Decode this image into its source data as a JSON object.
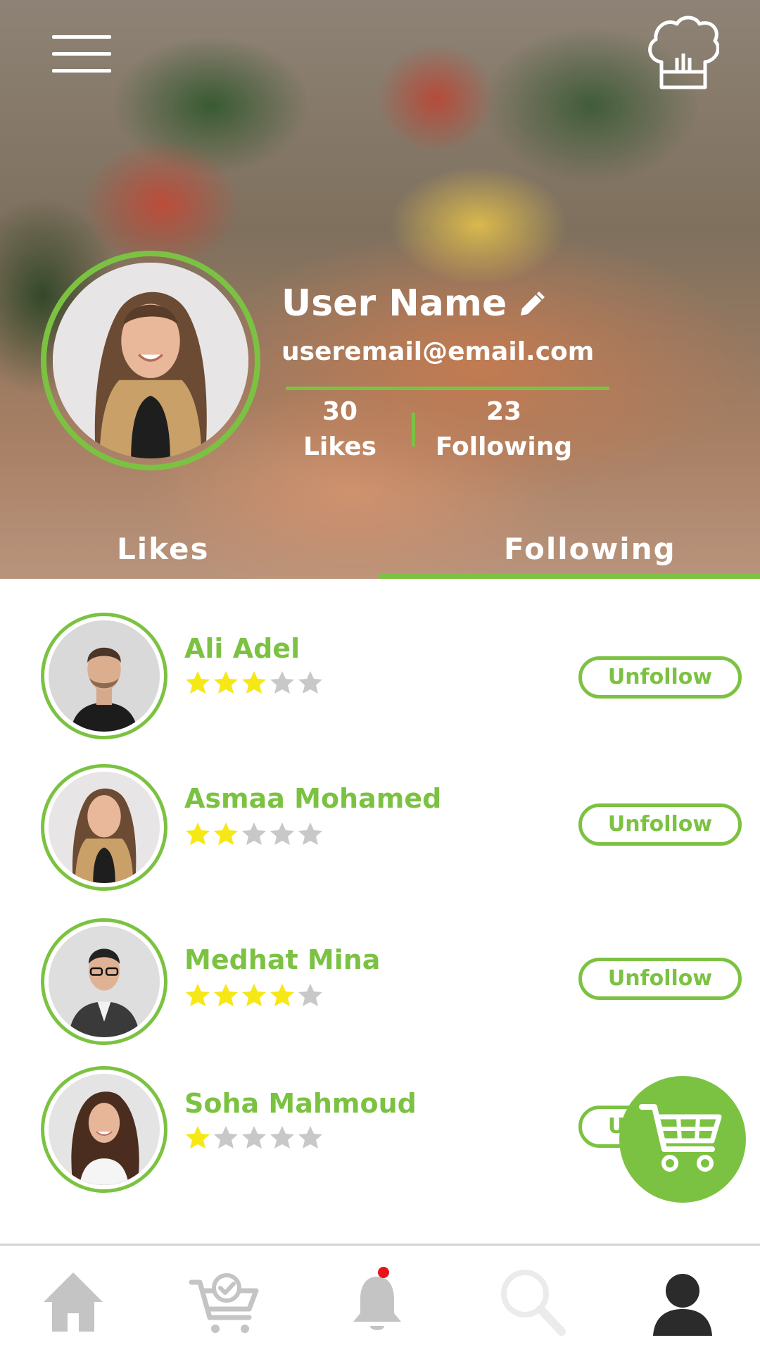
{
  "header": {
    "user_name": "User Name",
    "user_email": "useremail@email.com",
    "stats": {
      "likes_count": "30",
      "likes_label": "Likes",
      "following_count": "23",
      "following_label": "Following"
    },
    "tabs": [
      {
        "label": "Likes",
        "active": false
      },
      {
        "label": "Following",
        "active": true
      }
    ],
    "icons": {
      "menu": "hamburger-menu-icon",
      "chef": "chef-hat-icon",
      "edit": "pencil-icon"
    }
  },
  "following": [
    {
      "name": "Ali Adel",
      "rating": 3,
      "button_label": "Unfollow"
    },
    {
      "name": "Asmaa Mohamed",
      "rating": 2,
      "button_label": "Unfollow"
    },
    {
      "name": "Medhat Mina",
      "rating": 4,
      "button_label": "Unfollow"
    },
    {
      "name": "Soha Mahmoud",
      "rating": 1,
      "button_label": "Unfollow"
    }
  ],
  "bottom_nav": [
    {
      "icon": "home-icon",
      "active": false
    },
    {
      "icon": "cart-check-icon",
      "active": false
    },
    {
      "icon": "bell-icon",
      "active": false,
      "has_notification": true
    },
    {
      "icon": "search-icon",
      "active": false
    },
    {
      "icon": "profile-icon",
      "active": true
    }
  ],
  "colors": {
    "accent": "#7cc242",
    "star_filled": "#f5e816",
    "star_empty": "#c8c8c8",
    "nav_inactive": "#c4c4c4",
    "nav_active": "#2b2b2b",
    "notification": "#e8141b"
  }
}
